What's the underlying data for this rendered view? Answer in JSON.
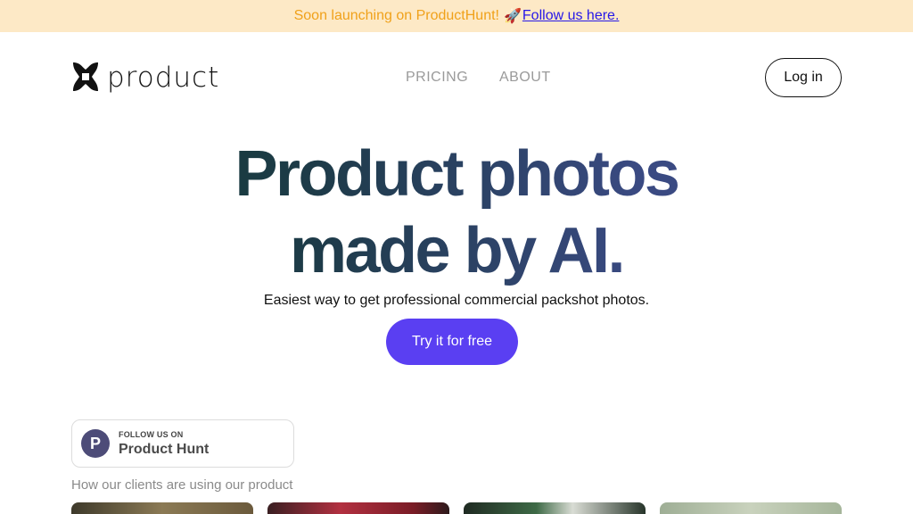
{
  "banner": {
    "text": "Soon launching on ProductHunt!",
    "rocket": "🚀",
    "link": "Follow us here."
  },
  "logo": {
    "word": "product",
    "icon": "flower-logo-icon"
  },
  "nav": {
    "pricing": "PRICING",
    "about": "ABOUT"
  },
  "login_label": "Log in",
  "hero": {
    "line1": "Product photos",
    "line2": "made by AI.",
    "subtitle": "Easiest way to get professional commercial packshot photos.",
    "cta": "Try it for free"
  },
  "product_hunt_badge": {
    "small": "FOLLOW US ON",
    "big": "Product Hunt",
    "letter": "P"
  },
  "clients_label": "How our clients are using our product",
  "colors": {
    "banner_bg": "#fde9c6",
    "banner_text": "#f0a11a",
    "link": "#2618e8",
    "cta_bg": "#5a3ff2",
    "headline_start": "#0e3a2c",
    "headline_end": "#3b4680"
  }
}
